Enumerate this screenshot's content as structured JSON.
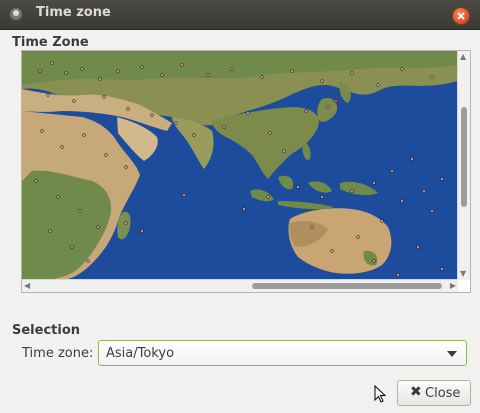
{
  "window": {
    "title": "Time zone",
    "icon": "app-icon",
    "close_icon": "close-icon"
  },
  "map_section": {
    "title": "Time Zone"
  },
  "selection_section": {
    "title": "Selection",
    "timezone_label": "Time zone:",
    "timezone_value": "Asia/Tokyo"
  },
  "buttons": {
    "close_label": "Close",
    "close_icon": "close-x-icon"
  },
  "colors": {
    "ocean": "#1d4c9c",
    "land_green": "#6f8a4a",
    "land_desert": "#d2b88a",
    "accent_border": "#8fb463"
  }
}
